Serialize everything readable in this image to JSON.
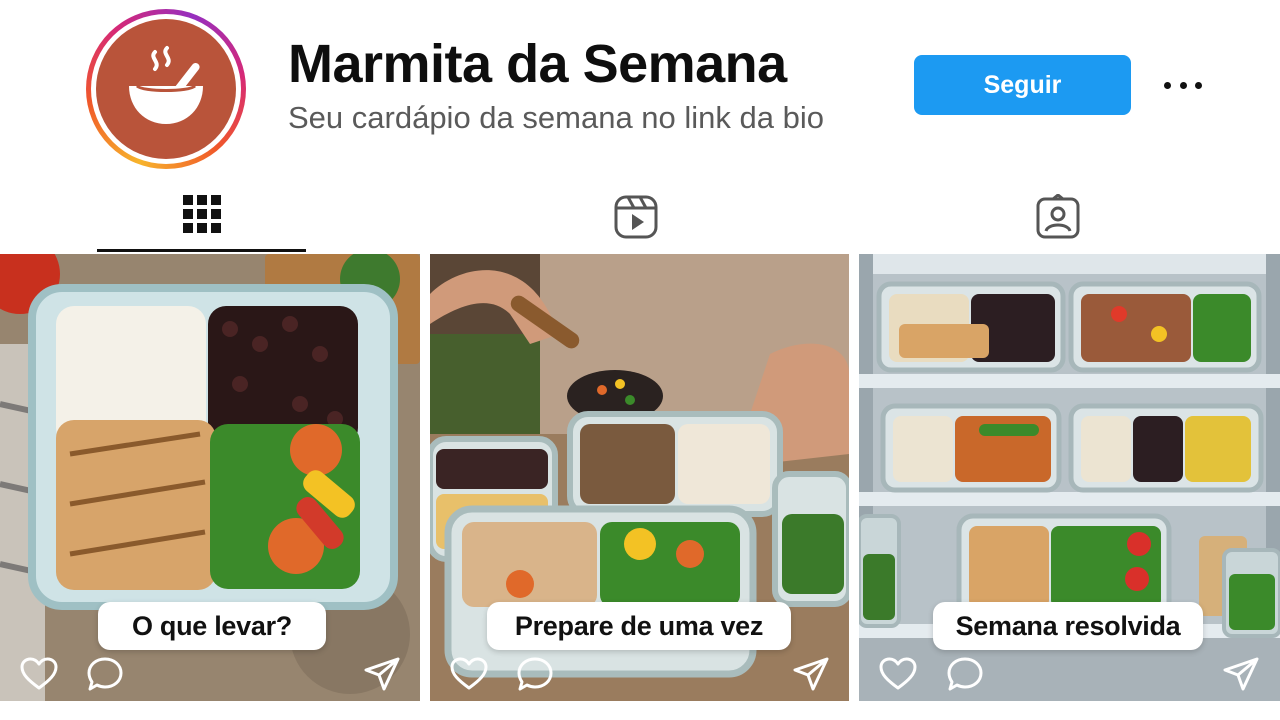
{
  "profile": {
    "name": "Marmita da Semana",
    "bio": "Seu cardápio da semana no link da bio",
    "follow_label": "Seguir",
    "avatar_icon": "soup-bowl-icon",
    "avatar_color": "#b9543a",
    "accent_color": "#1c9af2"
  },
  "tabs": [
    {
      "name": "grid",
      "icon": "grid-icon",
      "active": true
    },
    {
      "name": "reels",
      "icon": "reels-icon",
      "active": false
    },
    {
      "name": "tagged",
      "icon": "tagged-icon",
      "active": false
    }
  ],
  "posts": [
    {
      "caption": "O que levar?",
      "image": "meal-prep-container-rice-beans-chicken-vegetables"
    },
    {
      "caption": "Prepare de uma vez",
      "image": "hands-serving-food-into-containers"
    },
    {
      "caption": "Semana resolvida",
      "image": "fridge-shelves-with-meal-containers"
    }
  ],
  "post_actions": [
    "heart-icon",
    "comment-icon",
    "share-icon"
  ]
}
